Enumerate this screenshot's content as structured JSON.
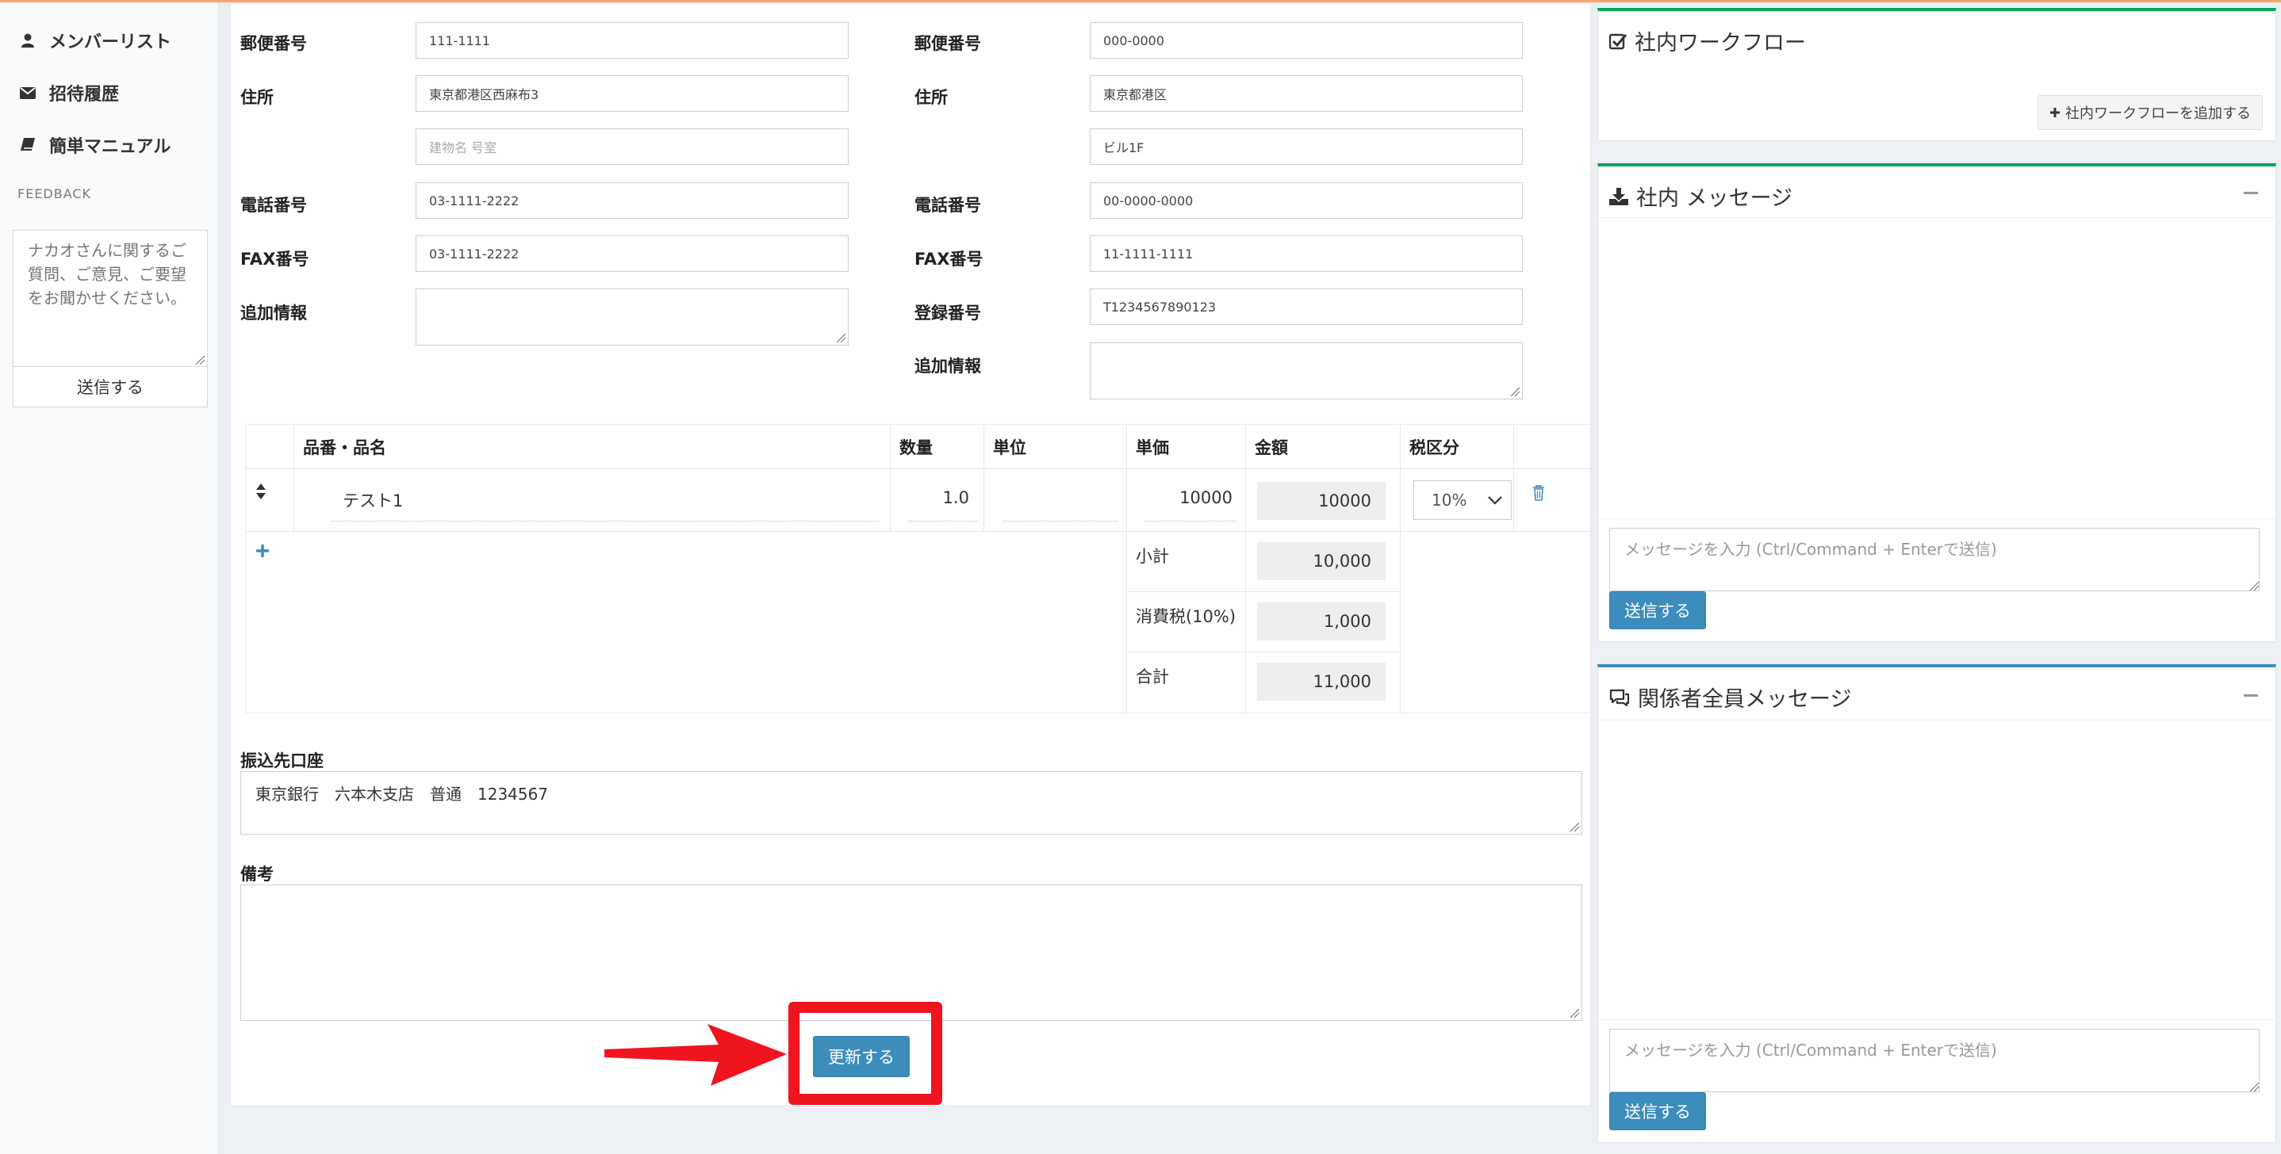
{
  "sidebar": {
    "nav": [
      {
        "label": "メンバーリスト",
        "icon": "user-icon"
      },
      {
        "label": "招待履歴",
        "icon": "envelope-icon"
      },
      {
        "label": "簡単マニュアル",
        "icon": "book-icon"
      }
    ],
    "feedback_label": "FEEDBACK",
    "feedback_placeholder": "ナカオさんに関するご質問、ご意見、ご要望をお聞かせください。",
    "feedback_send": "送信する"
  },
  "form": {
    "left": {
      "postal_label": "郵便番号",
      "postal": "111-1111",
      "address_label": "住所",
      "address": "東京都港区西麻布3",
      "building_placeholder": "建物名 号室",
      "phone_label": "電話番号",
      "phone": "03-1111-2222",
      "fax_label": "FAX番号",
      "fax": "03-1111-2222",
      "extra_label": "追加情報"
    },
    "right": {
      "postal_label": "郵便番号",
      "postal": "000-0000",
      "address_label": "住所",
      "address": "東京都港区",
      "building": "ビル1F",
      "phone_label": "電話番号",
      "phone": "00-0000-0000",
      "fax_label": "FAX番号",
      "fax": "11-1111-1111",
      "reg_label": "登録番号",
      "reg": "T1234567890123",
      "extra_label": "追加情報"
    }
  },
  "items": {
    "headers": {
      "name": "品番・品名",
      "qty": "数量",
      "unit": "単位",
      "price": "単価",
      "amount": "金額",
      "tax": "税区分"
    },
    "rows": [
      {
        "name": "テスト1",
        "qty": "1.0",
        "unit": "",
        "price": "10000",
        "amount": "10000",
        "tax": "10%"
      }
    ],
    "subtotal_label": "小計",
    "subtotal": "10,000",
    "tax_label": "消費税(10%)",
    "tax_value": "1,000",
    "total_label": "合計",
    "total": "11,000"
  },
  "bank": {
    "label": "振込先口座",
    "value": "東京銀行　六本木支店　普通　1234567"
  },
  "notes": {
    "label": "備考"
  },
  "update_button": "更新する",
  "workflow": {
    "title": "社内ワークフロー",
    "add_button": "社内ワークフローを追加する"
  },
  "internal_messages": {
    "title": "社内 メッセージ",
    "placeholder": "メッセージを入力 (Ctrl/Command + Enterで送信)",
    "send": "送信する"
  },
  "all_messages": {
    "title": "関係者全員メッセージ",
    "placeholder": "メッセージを入力 (Ctrl/Command + Enterで送信)",
    "send": "送信する"
  },
  "colors": {
    "primary": "#3c8dbc",
    "highlight": "#f0141e",
    "arrow": "#f0141e",
    "accent_green": "#00a65a",
    "accent_blue": "#3c8dbc"
  }
}
